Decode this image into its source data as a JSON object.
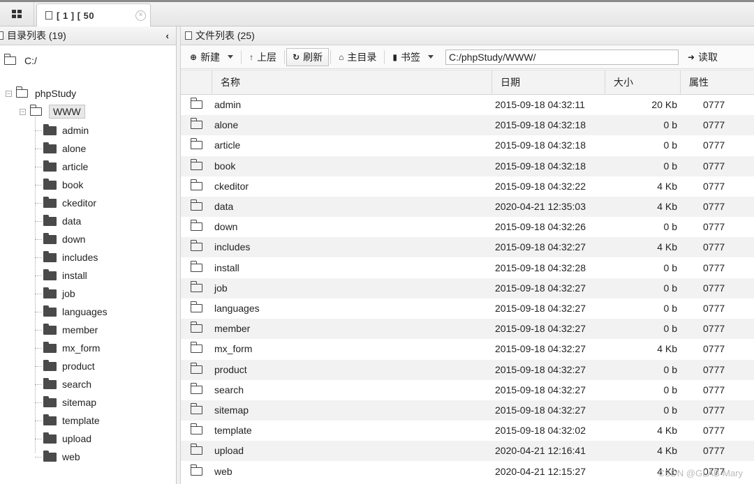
{
  "top_tab": {
    "title": "[ 1 ]  [ 50",
    "close": "×"
  },
  "left_panel": {
    "title": "目录列表 (19)",
    "collapse": "‹",
    "root": "C:/",
    "level1": "phpStudy",
    "level2": "WWW",
    "children": [
      "admin",
      "alone",
      "article",
      "book",
      "ckeditor",
      "data",
      "down",
      "includes",
      "install",
      "job",
      "languages",
      "member",
      "mx_form",
      "product",
      "search",
      "sitemap",
      "template",
      "upload",
      "web"
    ]
  },
  "right_panel": {
    "title": "文件列表 (25)",
    "toolbar": {
      "new_label": "新建",
      "up_label": "上层",
      "refresh_label": "刷新",
      "home_label": "主目录",
      "bookmark_label": "书签",
      "path_value": "C:/phpStudy/WWW/",
      "read_label": "读取"
    },
    "columns": {
      "name": "名称",
      "date": "日期",
      "size": "大小",
      "attr": "属性"
    },
    "files": [
      {
        "name": "admin",
        "date": "2015-09-18 04:32:11",
        "size": "20 Kb",
        "attr": "0777"
      },
      {
        "name": "alone",
        "date": "2015-09-18 04:32:18",
        "size": "0 b",
        "attr": "0777"
      },
      {
        "name": "article",
        "date": "2015-09-18 04:32:18",
        "size": "0 b",
        "attr": "0777"
      },
      {
        "name": "book",
        "date": "2015-09-18 04:32:18",
        "size": "0 b",
        "attr": "0777"
      },
      {
        "name": "ckeditor",
        "date": "2015-09-18 04:32:22",
        "size": "4 Kb",
        "attr": "0777"
      },
      {
        "name": "data",
        "date": "2020-04-21 12:35:03",
        "size": "4 Kb",
        "attr": "0777"
      },
      {
        "name": "down",
        "date": "2015-09-18 04:32:26",
        "size": "0 b",
        "attr": "0777"
      },
      {
        "name": "includes",
        "date": "2015-09-18 04:32:27",
        "size": "4 Kb",
        "attr": "0777"
      },
      {
        "name": "install",
        "date": "2015-09-18 04:32:28",
        "size": "0 b",
        "attr": "0777"
      },
      {
        "name": "job",
        "date": "2015-09-18 04:32:27",
        "size": "0 b",
        "attr": "0777"
      },
      {
        "name": "languages",
        "date": "2015-09-18 04:32:27",
        "size": "0 b",
        "attr": "0777"
      },
      {
        "name": "member",
        "date": "2015-09-18 04:32:27",
        "size": "0 b",
        "attr": "0777"
      },
      {
        "name": "mx_form",
        "date": "2015-09-18 04:32:27",
        "size": "4 Kb",
        "attr": "0777"
      },
      {
        "name": "product",
        "date": "2015-09-18 04:32:27",
        "size": "0 b",
        "attr": "0777"
      },
      {
        "name": "search",
        "date": "2015-09-18 04:32:27",
        "size": "0 b",
        "attr": "0777"
      },
      {
        "name": "sitemap",
        "date": "2015-09-18 04:32:27",
        "size": "0 b",
        "attr": "0777"
      },
      {
        "name": "template",
        "date": "2015-09-18 04:32:02",
        "size": "4 Kb",
        "attr": "0777"
      },
      {
        "name": "upload",
        "date": "2020-04-21 12:16:41",
        "size": "4 Kb",
        "attr": "0777"
      },
      {
        "name": "web",
        "date": "2020-04-21 12:15:27",
        "size": "4 Kb",
        "attr": "0777"
      }
    ]
  },
  "watermark": "CSDN @GLAB-Mary"
}
